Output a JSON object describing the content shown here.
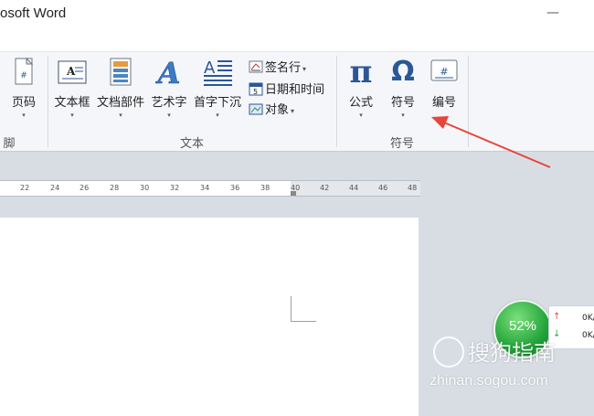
{
  "window": {
    "title": "osoft Word",
    "minimize_glyph": "—"
  },
  "ribbon": {
    "groups": [
      {
        "label": "脚"
      },
      {
        "label": "文本"
      },
      {
        "label": "符号"
      }
    ],
    "buttons": {
      "page_number": "页码",
      "text_box": "文本框",
      "quick_parts": "文档部件",
      "wordart": "艺术字",
      "drop_cap": "首字下沉",
      "signature_line": "签名行",
      "date_time": "日期和时间",
      "object": "对象",
      "equation": "公式",
      "symbol": "符号",
      "numbering": "编号"
    },
    "dropdown_arrow": "▾",
    "icons": {
      "equation_glyph": "π",
      "symbol_glyph": "Ω",
      "number_glyph": "#"
    }
  },
  "ruler": {
    "ticks": [
      "22",
      "24",
      "26",
      "28",
      "30",
      "32",
      "34",
      "36",
      "38",
      "40",
      "42",
      "44",
      "46",
      "48"
    ]
  },
  "widget": {
    "percent": "52%",
    "upload": "0K/",
    "download": "0K/"
  },
  "watermark": {
    "brand": "搜狗指南",
    "url": "zhinan.sogou.com"
  },
  "colors": {
    "annotation_arrow": "#e8453c",
    "accent_blue": "#2b5797"
  }
}
